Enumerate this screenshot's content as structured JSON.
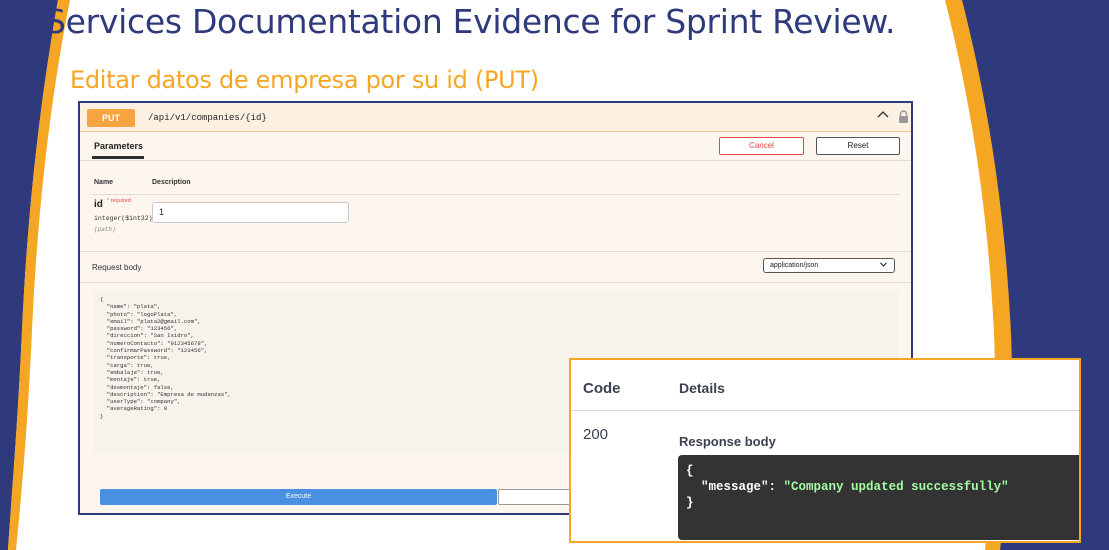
{
  "slide": {
    "title": "Services Documentation Evidence for Sprint Review.",
    "subtitle": "Editar datos de empresa por su id (PUT)",
    "colors": {
      "navy": "#2e3a7c",
      "accent": "#f5a623"
    }
  },
  "operation": {
    "method": "PUT",
    "path": "/api/v1/companies/{id}",
    "collapse_icon": "chevron-up-icon",
    "lock_icon": "lock-icon"
  },
  "parameters": {
    "tab_label": "Parameters",
    "cancel_label": "Cancel",
    "reset_label": "Reset",
    "col_name": "Name",
    "col_description": "Description",
    "param": {
      "name": "id",
      "required": "* required",
      "type": "integer($int32)",
      "location": "(path)",
      "value": "1"
    }
  },
  "request_body": {
    "label": "Request body",
    "content_type": "application/json",
    "lines": [
      "{",
      "  \"name\": \"plata\",",
      "  \"photo\": \"logoPlata\",",
      "  \"email\": \"plata2@gmail.com\",",
      "  \"password\": \"123456\",",
      "  \"direccion\": \"San Isidro\",",
      "  \"numeroContacto\": \"912345678\",",
      "  \"confirmarPassword\": \"123456\",",
      "  \"transporte\": true,",
      "  \"carga\": true,",
      "  \"embalaje\": true,",
      "  \"montaje\": true,",
      "  \"desmontaje\": false,",
      "  \"description\": \"Empresa de mudanzas\",",
      "  \"userType\": \"company\",",
      "  \"averageRating\": 0",
      "}"
    ]
  },
  "execute": {
    "label": "Execute",
    "clear_label": ""
  },
  "responses": {
    "code_header": "Code",
    "details_header": "Details",
    "code": "200",
    "body_label": "Response body",
    "open_brace": "{",
    "close_brace": "}",
    "key": "\"message\"",
    "separator": ": ",
    "value": "\"Company updated successfully\""
  }
}
